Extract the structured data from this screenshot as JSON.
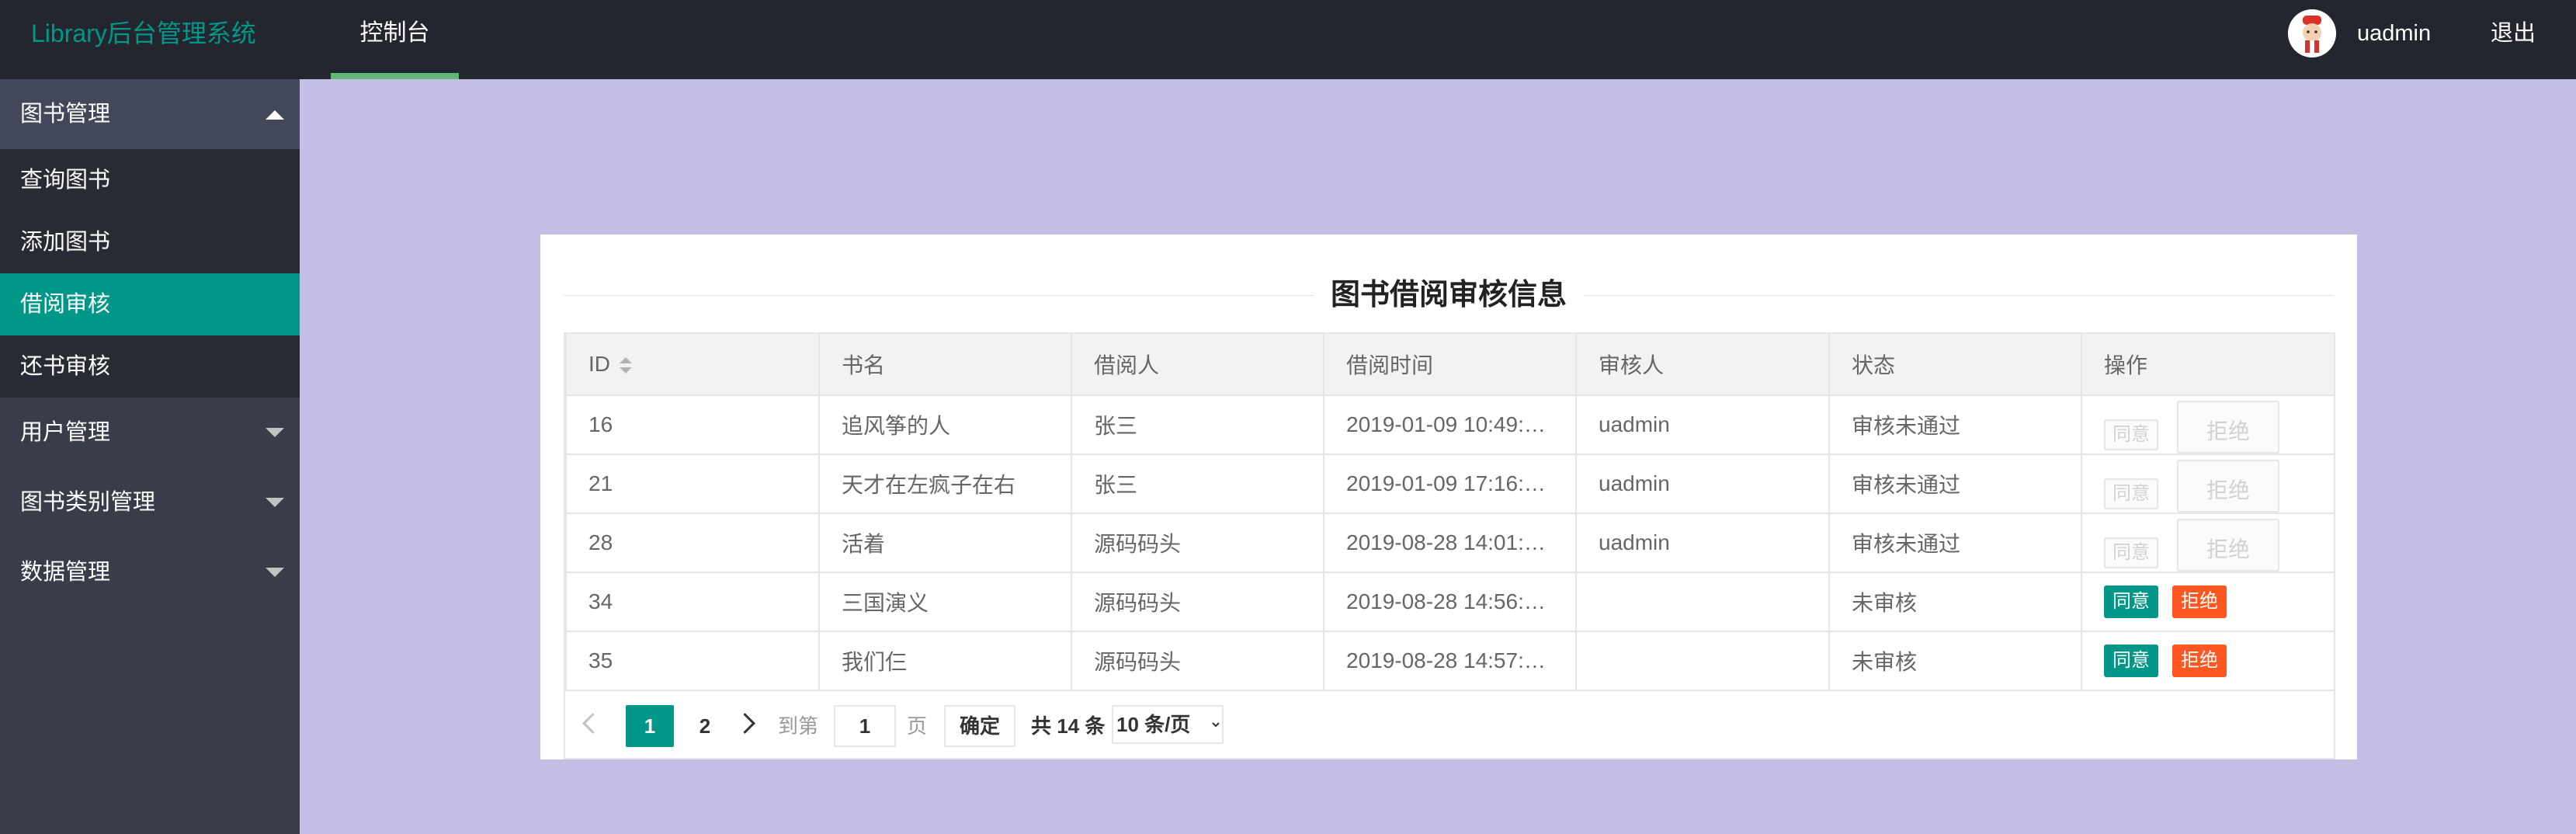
{
  "header": {
    "logo": "Library后台管理系统",
    "nav_tab": "控制台",
    "user_name": "uadmin",
    "logout": "退出"
  },
  "sidebar": {
    "groups": [
      {
        "label": "图书管理",
        "expanded": true,
        "items": [
          "查询图书",
          "添加图书",
          "借阅审核",
          "还书审核"
        ],
        "active": "借阅审核"
      },
      {
        "label": "用户管理",
        "expanded": false
      },
      {
        "label": "图书类别管理",
        "expanded": false
      },
      {
        "label": "数据管理",
        "expanded": false
      }
    ]
  },
  "main": {
    "title": "图书借阅审核信息",
    "columns": [
      "ID",
      "书名",
      "借阅人",
      "借阅时间",
      "审核人",
      "状态",
      "操作"
    ],
    "rows": [
      {
        "id": "16",
        "book": "追风筝的人",
        "borrower": "张三",
        "time": "2019-01-09 10:49:…",
        "reviewer": "uadmin",
        "status": "审核未通过",
        "actions_enabled": false
      },
      {
        "id": "21",
        "book": "天才在左疯子在右",
        "borrower": "张三",
        "time": "2019-01-09 17:16:…",
        "reviewer": "uadmin",
        "status": "审核未通过",
        "actions_enabled": false
      },
      {
        "id": "28",
        "book": "活着",
        "borrower": "源码码头",
        "time": "2019-08-28 14:01:…",
        "reviewer": "uadmin",
        "status": "审核未通过",
        "actions_enabled": false
      },
      {
        "id": "34",
        "book": "三国演义",
        "borrower": "源码码头",
        "time": "2019-08-28 14:56:…",
        "reviewer": "",
        "status": "未审核",
        "actions_enabled": true
      },
      {
        "id": "35",
        "book": "我们仨",
        "borrower": "源码码头",
        "time": "2019-08-28 14:57:…",
        "reviewer": "",
        "status": "未审核",
        "actions_enabled": true
      }
    ],
    "actions": {
      "agree": "同意",
      "refuse": "拒绝"
    }
  },
  "pager": {
    "current": "1",
    "page2": "2",
    "goto_label": "到第",
    "goto_value": "1",
    "page_label": "页",
    "confirm": "确定",
    "total": "共 14 条",
    "page_size": "10 条/页"
  },
  "colors": {
    "header_bg": "#23262e",
    "sidebar_bg": "#393d49",
    "accent": "#009688",
    "refuse": "#ff5722",
    "page_bg": "#c5bde6",
    "logo": "#009688"
  }
}
